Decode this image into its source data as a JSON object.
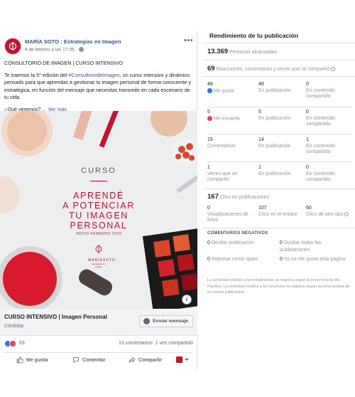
{
  "post": {
    "page_name": "MARÍA SOTO : Estrategias en Imagen",
    "date": "6 de febrero a las 17:35 ·",
    "title_line": "CONSULTORIO DE IMAGEN | CURSO INTENSIVO",
    "body_prefix": "Te traemos la 5° edición del ",
    "hashtag": "#ConsultoriodeImagen",
    "body_suffix": ", un curso intensivo y dinámico pensado para que aprendas a gestionar tu imagen personal de forma consciente y estratégica, en función del mensaje que necesitas transmitir en cada escenario de tu vida.",
    "question": "¿Qué veremos? ...",
    "see_more": "Ver más",
    "creative": {
      "curso": "CURSO",
      "headline": [
        "APRENDÉ",
        "A POTENCIAR",
        "TU IMAGEN",
        "PERSONAL"
      ],
      "date": "INICIO FEBRERO 2019",
      "logo_name": "MARIASOTO",
      "logo_sub": "Estrategias en Imagen"
    },
    "cta": {
      "title": "CURSO INTENSIVO | Imagen Personal",
      "location": "Córdoba",
      "button": "Enviar mensaje"
    },
    "reactions_count": "53",
    "comments": "13 comentarios",
    "shares": "1 vez compartido",
    "actions": {
      "like": "Me gusta",
      "comment": "Comentar",
      "share": "Compartir"
    }
  },
  "insights": {
    "title": "Rendimiento de tu publicación",
    "reach_value": "13.369",
    "reach_label": "Personas alcanzadas",
    "engagement_value": "69",
    "engagement_label": "Reacciones, comentarios y veces que se compartió",
    "rows": [
      {
        "total": "48",
        "label": "Me gusta",
        "on_post": "48",
        "on_post_label": "En publicación",
        "shared": "0",
        "shared_label": "En contenido compartido"
      },
      {
        "total": "5",
        "label": "Me encanta",
        "on_post": "5",
        "on_post_label": "En publicación",
        "shared": "0",
        "shared_label": "En contenido compartido"
      },
      {
        "total": "15",
        "label": "Comentarios",
        "on_post": "14",
        "on_post_label": "En publicación",
        "shared": "1",
        "shared_label": "En contenido compartido"
      },
      {
        "total": "1",
        "label": "Veces que se compartió",
        "on_post": "1",
        "on_post_label": "En publicación",
        "shared": "0",
        "shared_label": "En contenido compartido"
      }
    ],
    "clicks_value": "167",
    "clicks_label": "Clics en publicaciones",
    "click_breakdown": [
      {
        "value": "0",
        "label": "Visualizaciones de fotos"
      },
      {
        "value": "107",
        "label": "Clics en el enlace"
      },
      {
        "value": "60",
        "label": "Clics de otro tipo"
      }
    ],
    "negative_title": "COMENTARIOS NEGATIVOS",
    "negative": [
      {
        "value": "0",
        "label": "Ocultar publicación"
      },
      {
        "value": "0",
        "label": "Ocultar todas las publicaciones"
      },
      {
        "value": "0",
        "label": "Reportar como spam"
      },
      {
        "value": "0",
        "label": "Ya no me gusta esta página"
      }
    ],
    "footnote": "La actividad relativa a las estadísticas se registra según la zona horaria del Pacífico. La actividad relativa a los anuncios se registra según la zona horaria de tu cuenta publicitaria."
  },
  "colors": {
    "brand_red": "#c8102e",
    "link_blue": "#385898",
    "like_blue": "#2078f4",
    "love_red": "#f33e58"
  }
}
